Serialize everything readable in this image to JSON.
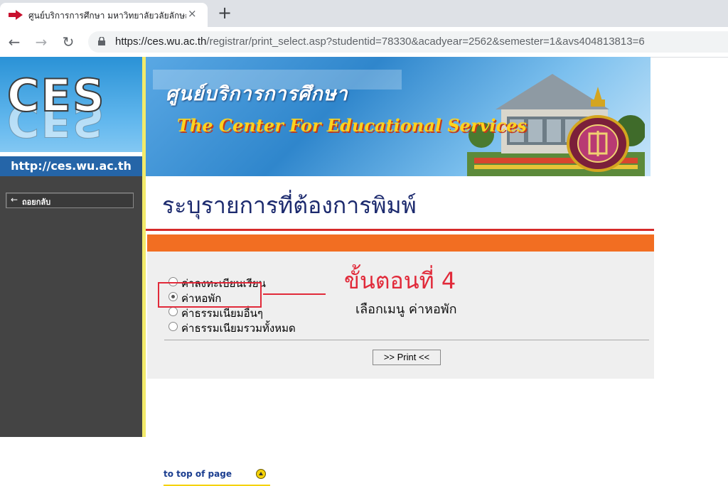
{
  "browser": {
    "tab_title": "ศูนย์บริการการศึกษา มหาวิทยาลัยวลัยลักษณ์",
    "tab_close": "×",
    "new_tab": "+",
    "url_host": "https://ces.wu.ac.th",
    "url_path": "/registrar/print_select.asp?studentid=78330&acadyear=2562&semester=1&avs404813813=6",
    "nav": {
      "back": "←",
      "forward": "→",
      "reload": "↻"
    }
  },
  "sidebar": {
    "logo_text": "CES",
    "site_url": "http://ces.wu.ac.th",
    "back_button": {
      "arrow": "←",
      "label": "ถอยกลับ"
    }
  },
  "banner": {
    "title_th": "ศูนย์บริการการศึกษา",
    "title_en": "The Center For Educational Services"
  },
  "main": {
    "page_title": "ระบุรายการที่ต้องการพิมพ์",
    "options": [
      {
        "label": "ค่าลงทะเบียนเรียน",
        "checked": false
      },
      {
        "label": "ค่าหอพัก",
        "checked": true
      },
      {
        "label": "ค่าธรรมเนียมอื่นๆ",
        "checked": false
      },
      {
        "label": "ค่าธรรมเนียมรวมทั้งหมด",
        "checked": false
      }
    ],
    "print_button": ">> Print <<"
  },
  "annotation": {
    "step": "ขั้นตอนที่ 4",
    "instruction": "เลือกเมนู ค่าหอพัก",
    "color": "#e12a3a"
  },
  "footer": {
    "to_top": "to top of page"
  },
  "colors": {
    "sidebar_bg": "#444444",
    "accent_orange": "#f26e22",
    "accent_red_line": "#d62a2a",
    "title_navy": "#1c2a6e",
    "divider_yellow": "#f2ea6a"
  }
}
